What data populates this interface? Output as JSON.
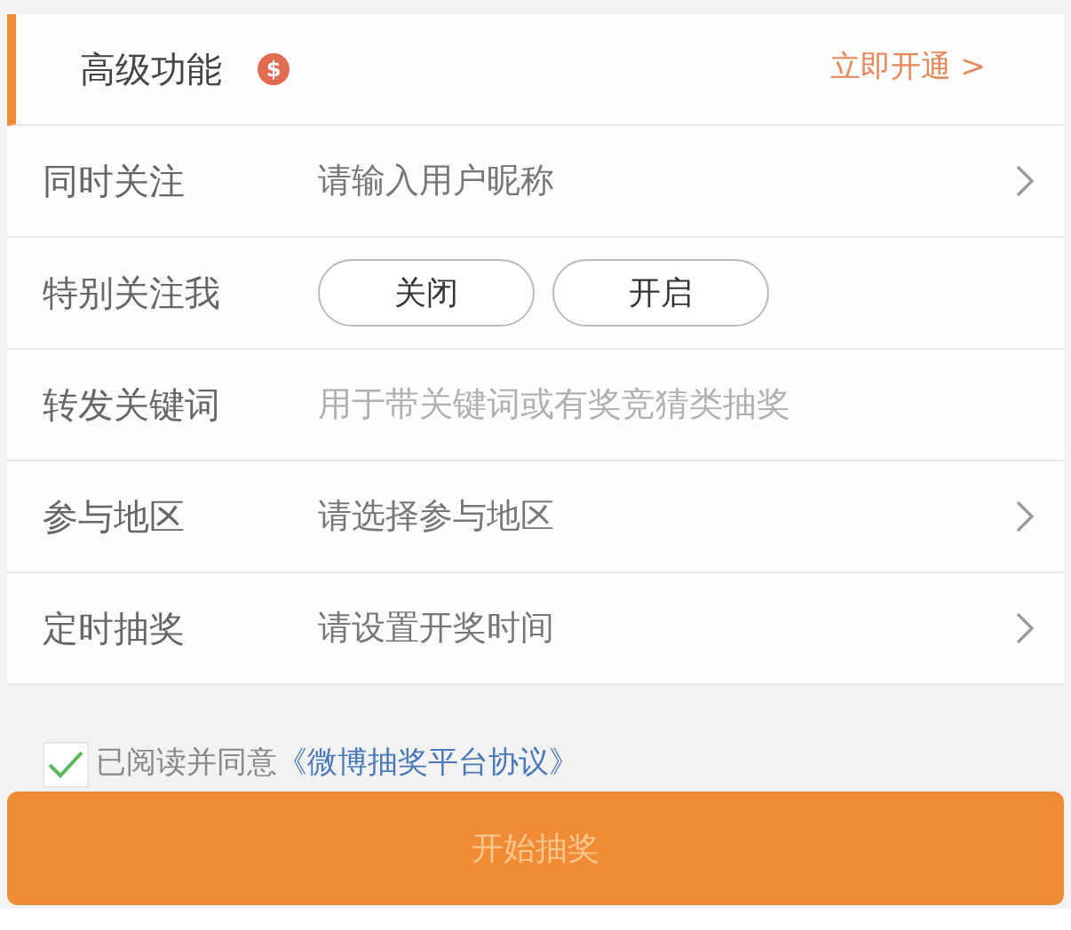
{
  "header": {
    "title": "高级功能",
    "badge": "$",
    "action": "立即开通 >"
  },
  "rows": [
    {
      "kind": "select",
      "label": "同时关注",
      "placeholder": "请输入用户昵称"
    },
    {
      "kind": "toggle",
      "label": "特别关注我",
      "options": [
        {
          "label": "关闭",
          "selected": false
        },
        {
          "label": "开启",
          "selected": false
        }
      ]
    },
    {
      "kind": "input",
      "label": "转发关键词",
      "placeholder": "用于带关键词或有奖竞猜类抽奖"
    },
    {
      "kind": "select",
      "label": "参与地区",
      "placeholder": "请选择参与地区"
    },
    {
      "kind": "select",
      "label": "定时抽奖",
      "placeholder": "请设置开奖时间"
    }
  ],
  "agreement": {
    "checked": true,
    "text": "已阅读并同意",
    "link": "《微博抽奖平台协议》"
  },
  "submit": {
    "label": "开始抽奖",
    "disabled": true
  }
}
